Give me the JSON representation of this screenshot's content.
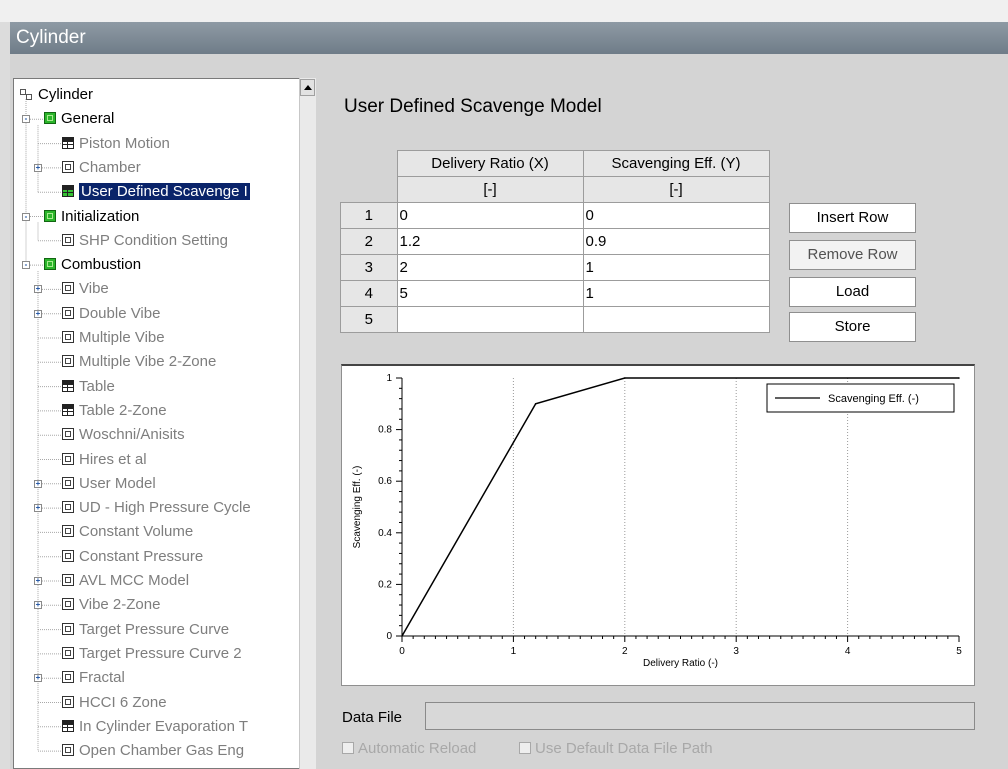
{
  "window": {
    "title": "Cylinder"
  },
  "tree": {
    "items": [
      {
        "label": "Cylinder",
        "level": 0,
        "icon": "hierarchy-icon",
        "dim": false,
        "expander": ""
      },
      {
        "label": "General",
        "level": 1,
        "icon": "green-group-icon",
        "dim": false,
        "expander": "-"
      },
      {
        "label": "Piston Motion",
        "level": 2,
        "icon": "table-icon",
        "dim": true,
        "expander": ""
      },
      {
        "label": "Chamber",
        "level": 2,
        "icon": "model-icon",
        "dim": true,
        "expander": "+"
      },
      {
        "label": "User Defined Scavenge I",
        "level": 2,
        "icon": "table-icon",
        "dim": false,
        "expander": "",
        "selected": true
      },
      {
        "label": "Initialization",
        "level": 1,
        "icon": "green-group-icon",
        "dim": false,
        "expander": "-"
      },
      {
        "label": "SHP Condition Setting",
        "level": 2,
        "icon": "model-icon",
        "dim": true,
        "expander": ""
      },
      {
        "label": "Combustion",
        "level": 1,
        "icon": "green-group-icon",
        "dim": false,
        "expander": "-"
      },
      {
        "label": "Vibe",
        "level": 2,
        "icon": "model-icon",
        "dim": true,
        "expander": "+"
      },
      {
        "label": "Double Vibe",
        "level": 2,
        "icon": "model-icon",
        "dim": true,
        "expander": "+"
      },
      {
        "label": "Multiple Vibe",
        "level": 2,
        "icon": "model-icon",
        "dim": true,
        "expander": ""
      },
      {
        "label": "Multiple Vibe 2-Zone",
        "level": 2,
        "icon": "model-icon",
        "dim": true,
        "expander": ""
      },
      {
        "label": "Table",
        "level": 2,
        "icon": "table-icon",
        "dim": true,
        "expander": ""
      },
      {
        "label": "Table 2-Zone",
        "level": 2,
        "icon": "table-icon",
        "dim": true,
        "expander": ""
      },
      {
        "label": "Woschni/Anisits",
        "level": 2,
        "icon": "model-icon",
        "dim": true,
        "expander": ""
      },
      {
        "label": "Hires et al",
        "level": 2,
        "icon": "model-icon",
        "dim": true,
        "expander": ""
      },
      {
        "label": "User Model",
        "level": 2,
        "icon": "model-icon",
        "dim": true,
        "expander": "+"
      },
      {
        "label": "UD - High Pressure Cycle",
        "level": 2,
        "icon": "model-icon",
        "dim": true,
        "expander": "+"
      },
      {
        "label": "Constant Volume",
        "level": 2,
        "icon": "model-icon",
        "dim": true,
        "expander": ""
      },
      {
        "label": "Constant Pressure",
        "level": 2,
        "icon": "model-icon",
        "dim": true,
        "expander": ""
      },
      {
        "label": "AVL MCC Model",
        "level": 2,
        "icon": "model-icon",
        "dim": true,
        "expander": "+"
      },
      {
        "label": "Vibe 2-Zone",
        "level": 2,
        "icon": "model-icon",
        "dim": true,
        "expander": "+"
      },
      {
        "label": "Target Pressure Curve",
        "level": 2,
        "icon": "model-icon",
        "dim": true,
        "expander": ""
      },
      {
        "label": "Target Pressure Curve 2",
        "level": 2,
        "icon": "model-icon",
        "dim": true,
        "expander": ""
      },
      {
        "label": "Fractal",
        "level": 2,
        "icon": "model-icon",
        "dim": true,
        "expander": "+"
      },
      {
        "label": "HCCI 6 Zone",
        "level": 2,
        "icon": "model-icon",
        "dim": true,
        "expander": ""
      },
      {
        "label": "In Cylinder Evaporation T",
        "level": 2,
        "icon": "table-icon",
        "dim": true,
        "expander": ""
      },
      {
        "label": "Open Chamber Gas Eng",
        "level": 2,
        "icon": "model-icon",
        "dim": true,
        "expander": ""
      }
    ]
  },
  "panel": {
    "title": "User Defined Scavenge Model",
    "table": {
      "columns": [
        "Delivery Ratio (X)",
        "Scavenging Eff. (Y)"
      ],
      "units": [
        "[-]",
        "[-]"
      ],
      "rows": [
        {
          "index": "1",
          "x": "0",
          "y": "0"
        },
        {
          "index": "2",
          "x": "1.2",
          "y": "0.9"
        },
        {
          "index": "3",
          "x": "2",
          "y": "1"
        },
        {
          "index": "4",
          "x": "5",
          "y": "1"
        },
        {
          "index": "5",
          "x": "",
          "y": ""
        }
      ]
    },
    "buttons": {
      "insert_row": "Insert Row",
      "remove_row": "Remove Row",
      "load": "Load",
      "store": "Store"
    },
    "data_file": {
      "label": "Data File",
      "value": ""
    },
    "options": {
      "automatic_reload": "Automatic Reload",
      "use_default_path": "Use Default Data File Path"
    }
  },
  "chart_data": {
    "type": "line",
    "x": [
      0,
      1.2,
      2,
      5
    ],
    "series": [
      {
        "name": "Scavenging Eff. (-)",
        "values": [
          0,
          0.9,
          1,
          1
        ]
      }
    ],
    "xlabel": "Delivery Ratio (-)",
    "ylabel": "Scavenging Eff. (-)",
    "xlim": [
      0,
      5
    ],
    "ylim": [
      0,
      1
    ],
    "xticks": [
      "0",
      "1",
      "2",
      "3",
      "4",
      "5"
    ],
    "yticks": [
      "0",
      "0.2",
      "0.4",
      "0.6",
      "0.8",
      "1"
    ],
    "grid": "vertical-dotted",
    "legend": "top-right"
  }
}
